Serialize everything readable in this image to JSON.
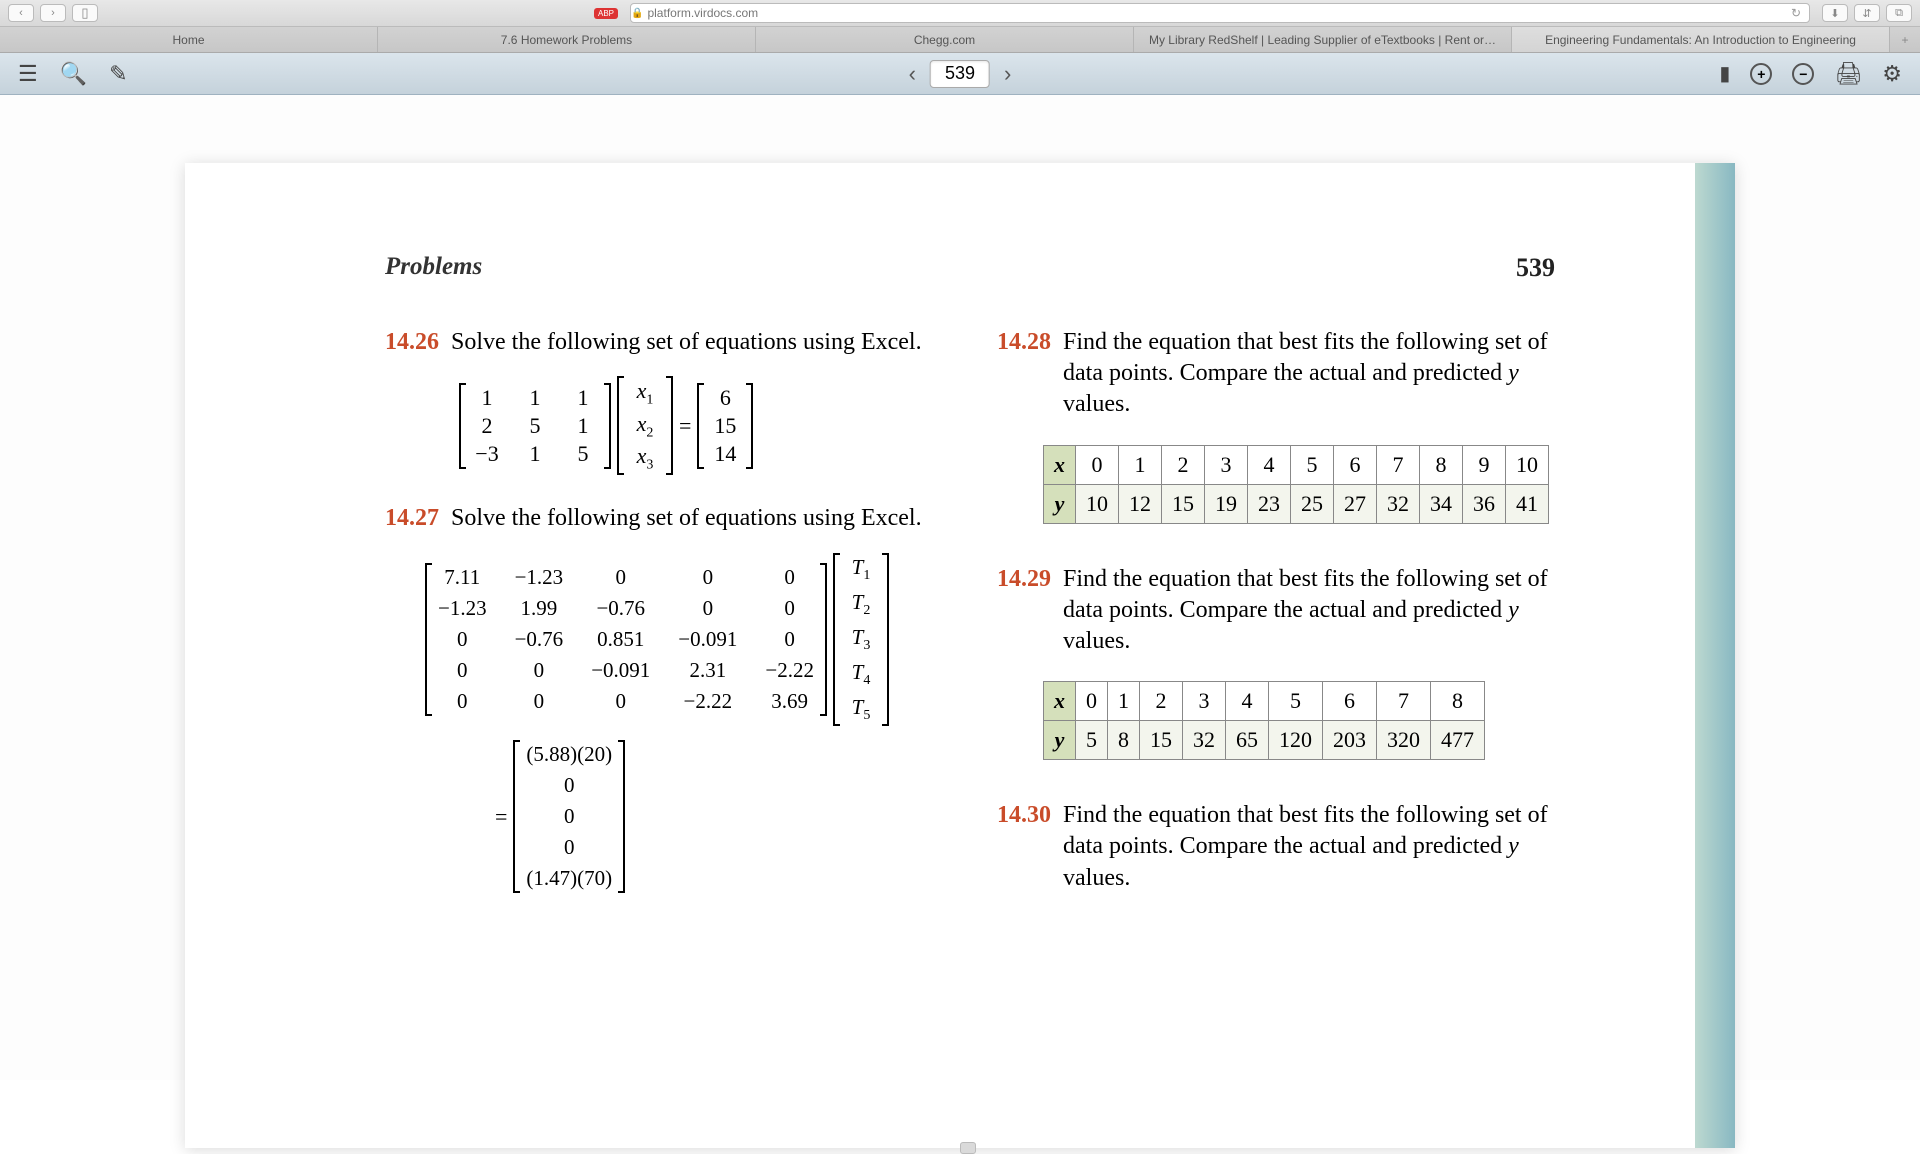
{
  "browser": {
    "url": "platform.virdocs.com",
    "tabs": [
      "Home",
      "7.6 Homework Problems",
      "Chegg.com",
      "My Library RedShelf | Leading Supplier of eTextbooks | Rent or…",
      "Engineering Fundamentals: An Introduction to Engineering"
    ]
  },
  "reader": {
    "page": "539"
  },
  "doc": {
    "heading": "Problems",
    "pagenum": "539",
    "p1426": {
      "num": "14.26",
      "text": "Solve the following set of equations using Excel.",
      "A": [
        [
          "1",
          "1",
          "1"
        ],
        [
          "2",
          "5",
          "1"
        ],
        [
          "−3",
          "1",
          "5"
        ]
      ],
      "x": [
        "x",
        "x",
        "x"
      ],
      "xsub": [
        "1",
        "2",
        "3"
      ],
      "b": [
        "6",
        "15",
        "14"
      ]
    },
    "p1427": {
      "num": "14.27",
      "text": "Solve the following set of equations using Excel.",
      "A": [
        [
          "7.11",
          "−1.23",
          "0",
          "0",
          "0"
        ],
        [
          "−1.23",
          "1.99",
          "−0.76",
          "0",
          "0"
        ],
        [
          "0",
          "−0.76",
          "0.851",
          "−0.091",
          "0"
        ],
        [
          "0",
          "0",
          "−0.091",
          "2.31",
          "−2.22"
        ],
        [
          "0",
          "0",
          "0",
          "−2.22",
          "3.69"
        ]
      ],
      "T": [
        "T",
        "T",
        "T",
        "T",
        "T"
      ],
      "Tsub": [
        "1",
        "2",
        "3",
        "4",
        "5"
      ],
      "b": [
        "(5.88)(20)",
        "0",
        "0",
        "0",
        "(1.47)(70)"
      ]
    },
    "p1428": {
      "num": "14.28",
      "text": "Find the equation that best fits the following set of data points. Compare the actual and predicted y values.",
      "x": [
        "0",
        "1",
        "2",
        "3",
        "4",
        "5",
        "6",
        "7",
        "8",
        "9",
        "10"
      ],
      "y": [
        "10",
        "12",
        "15",
        "19",
        "23",
        "25",
        "27",
        "32",
        "34",
        "36",
        "41"
      ]
    },
    "p1429": {
      "num": "14.29",
      "text": "Find the equation that best fits the following set of data points. Compare the actual and predicted y values.",
      "x": [
        "0",
        "1",
        "2",
        "3",
        "4",
        "5",
        "6",
        "7",
        "8"
      ],
      "y": [
        "5",
        "8",
        "15",
        "32",
        "65",
        "120",
        "203",
        "320",
        "477"
      ]
    },
    "p1430": {
      "num": "14.30",
      "text": "Find the equation that best fits the following set of data points. Compare the actual and predicted y values."
    }
  }
}
